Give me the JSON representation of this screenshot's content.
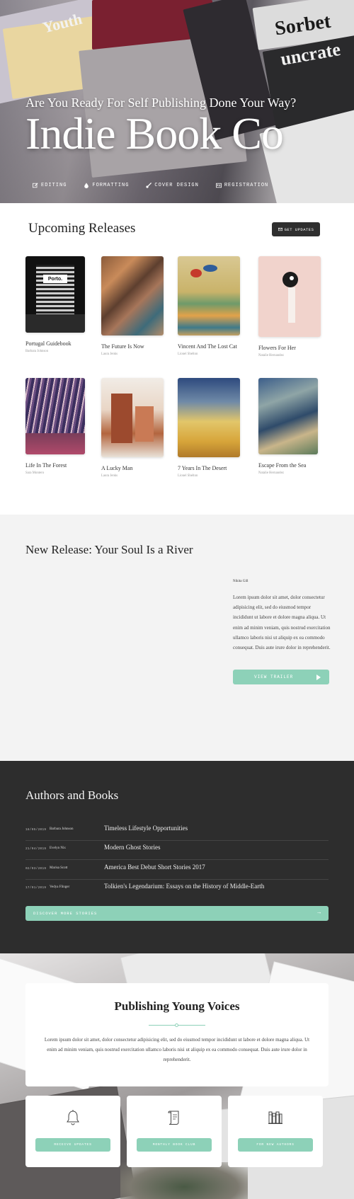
{
  "hero": {
    "tagline": "Are You Ready For Self Publishing Done Your Way?",
    "title": "Indie Book Co",
    "magazine_words": [
      "Sorbet",
      "uncrate",
      "Youth"
    ],
    "nav": [
      {
        "label": "EDITING",
        "icon": "edit-icon"
      },
      {
        "label": "FORMATTING",
        "icon": "tint-icon"
      },
      {
        "label": "COVER DESIGN",
        "icon": "brush-icon"
      },
      {
        "label": "REGISTRATION",
        "icon": "id-card-icon"
      }
    ]
  },
  "upcoming": {
    "heading": "Upcoming Releases",
    "get_updates": "GET UPDATES",
    "books": [
      {
        "title": "Portugal Guidebook",
        "author": "Barbara Johnson",
        "cover_text": "Porto."
      },
      {
        "title": "The Future Is Now",
        "author": "Laura Jenks"
      },
      {
        "title": "Vincent And The Lost Cat",
        "author": "Lionel Shelton"
      },
      {
        "title": "Flowers For Her",
        "author": "Natalie Hernandez"
      },
      {
        "title": "Life In The Forest",
        "author": "Sara Montero"
      },
      {
        "title": "A Lucky Man",
        "author": "Laura Jenks"
      },
      {
        "title": "7 Years In The Desert",
        "author": "Lionel Shelton"
      },
      {
        "title": "Escape From the Sea",
        "author": "Natalie Hernandez"
      }
    ]
  },
  "new_release": {
    "heading": "New Release: Your Soul Is a River",
    "author": "Nikita Gill",
    "body": "Lorem ipsum dolor sit amet, dolor consectetur adipisicing elit, sed do eiusmod tempor incididunt ut labore et dolore magna aliqua. Ut enim ad minim veniam, quis nostrud exercitation ullamco laboris nisi ut aliquip ex ea commodo consequat. Duis aute irure dolor in reprehenderit.",
    "button": "VIEW TRAILER"
  },
  "authors": {
    "heading": "Authors and Books",
    "rows": [
      {
        "date": "18/05/2019",
        "name": "Barbara Johnson",
        "book": "Timeless Lifestyle Opportunities"
      },
      {
        "date": "21/04/2019",
        "name": "Evelyn Nix",
        "book": "Modern Ghost Stories"
      },
      {
        "date": "02/03/2019",
        "name": "Marisa Scott",
        "book": "America Best Debut Short Stories 2017"
      },
      {
        "date": "17/01/2019",
        "name": "Vedya Flinger",
        "book": "Tolkien's Legendarium: Essays on the History of Middle-Earth"
      }
    ],
    "button": "DISCOVER MORE STORIES",
    "button_arrow": "→"
  },
  "publishing": {
    "heading": "Publishing Young Voices",
    "body": "Lorem ipsum dolor sit amet, dolor consectetur adipisicing elit, sed do eiusmod tempor incididunt ut labore et dolore magna aliqua. Ut enim ad minim veniam, quis nostrud exercitation ullamco laboris nisi ut aliquip ex ea commodo consequat. Duis aute irure dolor in reprehenderit.",
    "cards": [
      {
        "icon": "bell-icon",
        "button": "RECEIVE UPDATES"
      },
      {
        "icon": "scroll-icon",
        "button": "MONTHLY BOOK CLUB"
      },
      {
        "icon": "books-icon",
        "button": "FOR NEW AUTHORS"
      }
    ]
  },
  "colors": {
    "accent": "#8dd1b8",
    "dark": "#2d2d2d",
    "light_bg": "#f3f3f3"
  }
}
